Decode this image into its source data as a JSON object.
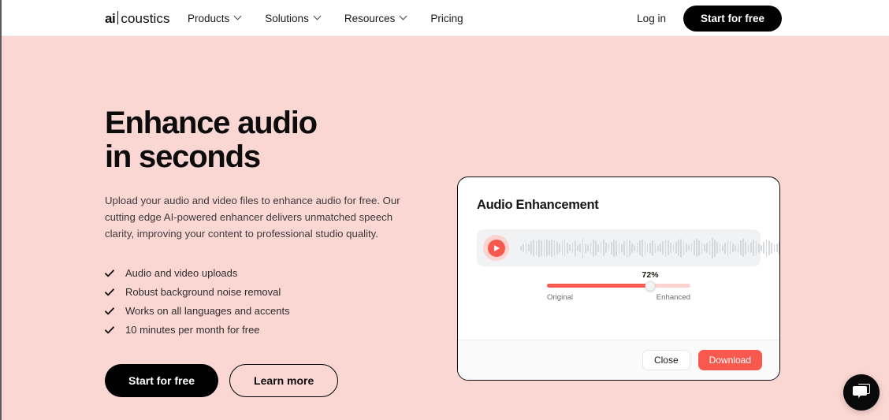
{
  "header": {
    "logo": {
      "bold": "ai",
      "separator": "|",
      "rest": "coustics"
    },
    "nav": [
      {
        "label": "Products",
        "has_chevron": true,
        "icon": "chevron-down-icon"
      },
      {
        "label": "Solutions",
        "has_chevron": true,
        "icon": "chevron-down-icon"
      },
      {
        "label": "Resources",
        "has_chevron": true,
        "icon": "chevron-down-icon"
      },
      {
        "label": "Pricing",
        "has_chevron": false,
        "icon": ""
      }
    ],
    "login_label": "Log in",
    "cta_label": "Start for free"
  },
  "hero": {
    "title": "Enhance audio\nin seconds",
    "subtitle": "Upload your audio and video files to enhance audio for free. Our cutting edge AI-powered enhancer delivers unmatched speech clarity, improving your content to professional studio quality.",
    "features": [
      {
        "icon": "check-icon",
        "label": "Audio and video uploads"
      },
      {
        "icon": "check-icon",
        "label": "Robust background noise removal"
      },
      {
        "icon": "check-icon",
        "label": "Works on all languages and accents"
      },
      {
        "icon": "check-icon",
        "label": "10 minutes per month for free"
      }
    ],
    "primary_button": "Start for free",
    "secondary_button": "Learn more",
    "background_color": "#fbd7d3"
  },
  "card": {
    "title": "Audio Enhancement",
    "player": {
      "play_icon": "play-icon",
      "play_color": "#f8594e",
      "play_ring_color": "#fbd3d0",
      "waveform_color": "#d6d9dc",
      "waveform_heights": [
        6,
        10,
        14,
        9,
        17,
        21,
        18,
        22,
        20,
        23,
        21,
        19,
        22,
        20,
        16,
        12,
        18,
        21,
        14,
        9,
        13,
        20,
        8,
        11,
        26,
        12,
        8,
        14,
        22,
        19,
        10,
        15,
        21,
        13,
        9,
        16,
        22,
        20,
        14,
        10,
        18,
        24,
        20,
        12,
        8,
        13,
        19,
        22,
        16,
        10,
        14,
        20,
        12,
        8,
        11,
        17,
        22,
        19,
        13,
        9,
        15,
        21,
        24,
        18,
        11,
        7,
        12,
        19,
        23,
        20,
        14,
        9,
        13,
        18,
        26,
        22,
        15,
        10,
        8,
        14,
        20,
        17,
        11,
        8,
        12,
        19,
        23,
        16,
        10,
        13,
        21,
        18,
        12,
        8,
        15,
        22,
        19,
        14,
        9,
        11,
        17,
        24,
        20,
        13,
        8,
        12,
        18,
        21,
        15,
        10,
        7,
        13,
        19,
        23,
        17,
        11,
        8,
        14,
        20,
        16,
        10,
        7,
        11,
        15,
        12,
        9,
        7,
        6
      ]
    },
    "slider": {
      "value_label": "72%",
      "value_percent": 72,
      "left_label": "Original",
      "right_label": "Enhanced",
      "fill_color": "#f8594e",
      "track_color": "#fbd3d0"
    },
    "footer": {
      "close_label": "Close",
      "download_label": "Download",
      "download_color": "#f8594e"
    }
  },
  "chat_widget": {
    "icon": "chat-bubble-icon",
    "background_color": "#0a0a0a"
  }
}
